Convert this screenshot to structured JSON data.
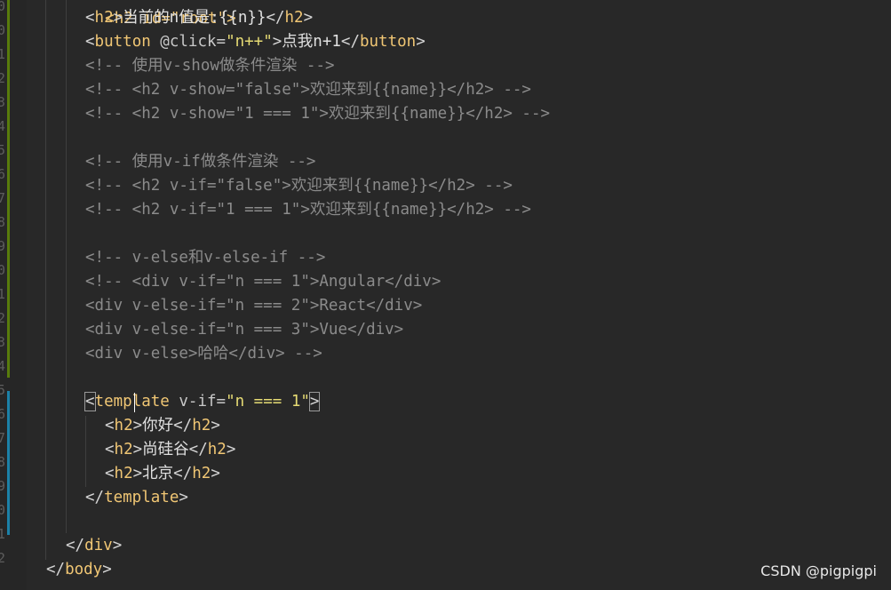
{
  "editor": {
    "gutter_numbers": [
      "0",
      "0",
      "1",
      "2",
      "3",
      "4",
      "5",
      "6",
      "7",
      "8",
      "9",
      "0",
      "1",
      "2",
      "3",
      "4",
      "5",
      "6",
      "7",
      "8",
      "9",
      "0",
      "1",
      "2"
    ],
    "top_partial": "<h2 id=\"root\">",
    "lines": {
      "l01": [
        "<",
        "h2",
        ">",
        "当前的n值是:{{n}}",
        "</",
        "h2",
        ">"
      ],
      "l02": [
        "<",
        "button",
        " @click=",
        "\"n++\"",
        ">",
        "点我n+1",
        "</",
        "button",
        ">"
      ],
      "l03": "<!-- 使用v-show做条件渲染 -->",
      "l04": "<!-- <h2 v-show=\"false\">欢迎来到{{name}}</h2> -->",
      "l05": "<!-- <h2 v-show=\"1 === 1\">欢迎来到{{name}}</h2> -->",
      "l07": "<!-- 使用v-if做条件渲染 -->",
      "l08": "<!-- <h2 v-if=\"false\">欢迎来到{{name}}</h2> -->",
      "l09": "<!-- <h2 v-if=\"1 === 1\">欢迎来到{{name}}</h2> -->",
      "l11": "<!-- v-else和v-else-if -->",
      "l12": "<!-- <div v-if=\"n === 1\">Angular</div>",
      "l13": "<div v-else-if=\"n === 2\">React</div>",
      "l14": "<div v-else-if=\"n === 3\">Vue</div>",
      "l15": "<div v-else>哈哈</div> -->",
      "l17": [
        "<",
        "template",
        " v-if=",
        "\"n === 1\"",
        ">"
      ],
      "l18": [
        "<",
        "h2",
        ">",
        "你好",
        "</",
        "h2",
        ">"
      ],
      "l19": [
        "<",
        "h2",
        ">",
        "尚硅谷",
        "</",
        "h2",
        ">"
      ],
      "l20": [
        "<",
        "h2",
        ">",
        "北京",
        "</",
        "h2",
        ">"
      ],
      "l21": [
        "</",
        "template",
        ">"
      ],
      "l23": [
        "</",
        "div",
        ">"
      ],
      "l24": [
        "</",
        "body",
        ">"
      ]
    }
  },
  "watermark": "CSDN @pigpigpi",
  "colors": {
    "background": "#282828",
    "tag": "#f0c674",
    "string": "#e6db74",
    "comment": "#8b8b8b",
    "modified_green": "#587c0c",
    "modified_blue": "#1b81a8"
  }
}
